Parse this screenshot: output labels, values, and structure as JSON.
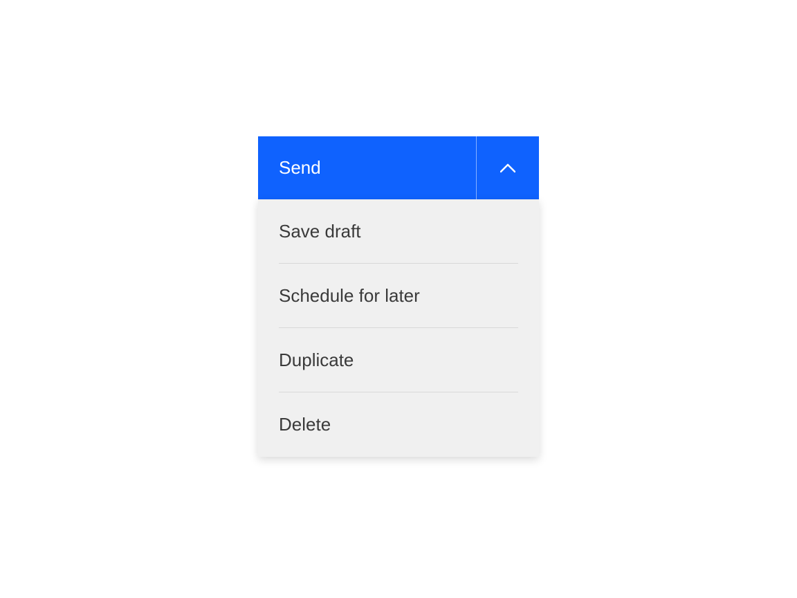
{
  "splitButton": {
    "primaryLabel": "Send",
    "accentColor": "#0f62fe",
    "menuItems": [
      {
        "label": "Save draft"
      },
      {
        "label": "Schedule for later"
      },
      {
        "label": "Duplicate"
      },
      {
        "label": "Delete"
      }
    ]
  }
}
